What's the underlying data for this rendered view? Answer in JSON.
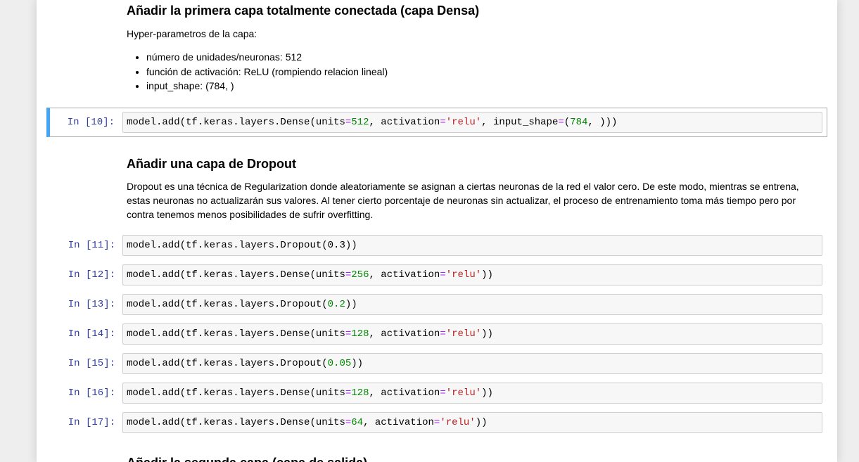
{
  "section1": {
    "heading": "Añadir la primera capa totalmente conectada (capa Densa)",
    "intro": "Hyper-parametros de la capa:",
    "bullets": [
      "número de unidades/neuronas: 512",
      "función de activación: ReLU (rompiendo relacion lineal)",
      "input_shape: (784, )"
    ]
  },
  "section2": {
    "heading": "Añadir una capa de Dropout",
    "paragraph": "Dropout es una técnica de Regularization donde aleatoriamente se asignan a ciertas neuronas de la red el valor cero. De este modo, mientras se entrena, estas neuronas no actualizarán sus valores. Al tener cierto porcentaje de neuronas sin actualizar, el proceso de entrenamiento toma más tiempo pero por contra tenemos menos posibilidades de sufrir overfitting."
  },
  "section3": {
    "heading": "Añadir la segunda capa (capa de salida)"
  },
  "cells": [
    {
      "prompt": "In [10]:",
      "pre": "model.add(tf.keras.layers.Dense(units",
      "op1": "=",
      "n1": "512",
      "mid": ", activation",
      "op2": "=",
      "s1": "'relu'",
      "mid2": ", input_shape",
      "op3": "=",
      "p1": "(",
      "n2": "784",
      "post": ", )))"
    },
    {
      "prompt": "In [11]:",
      "code": "model.add(tf.keras.layers.Dropout(0.3))"
    },
    {
      "prompt": "In [12]:",
      "pre": "model.add(tf.keras.layers.Dense(units",
      "n1": "256",
      "mid": ", activation",
      "s1": "'relu'",
      "post": "))"
    },
    {
      "prompt": "In [13]:",
      "pre": "model.add(tf.keras.layers.Dropout(",
      "n1": "0.2",
      "post": "))"
    },
    {
      "prompt": "In [14]:",
      "pre": "model.add(tf.keras.layers.Dense(units",
      "n1": "128",
      "mid": ", activation",
      "s1": "'relu'",
      "post": "))"
    },
    {
      "prompt": "In [15]:",
      "pre": "model.add(tf.keras.layers.Dropout(",
      "n1": "0.05",
      "post": "))"
    },
    {
      "prompt": "In [16]:",
      "pre": "model.add(tf.keras.layers.Dense(units",
      "n1": "128",
      "mid": ", activation",
      "s1": "'relu'",
      "post": "))"
    },
    {
      "prompt": "In [17]:",
      "pre": "model.add(tf.keras.layers.Dense(units",
      "n1": "64",
      "mid": ", activation",
      "s1": "'relu'",
      "post": "))"
    }
  ],
  "syntax_colors": {
    "number": "#008800",
    "string": "#ba2121",
    "operator": "#aa22ff",
    "prompt": "#303f9f",
    "selected_bar": "#42a5f5"
  }
}
